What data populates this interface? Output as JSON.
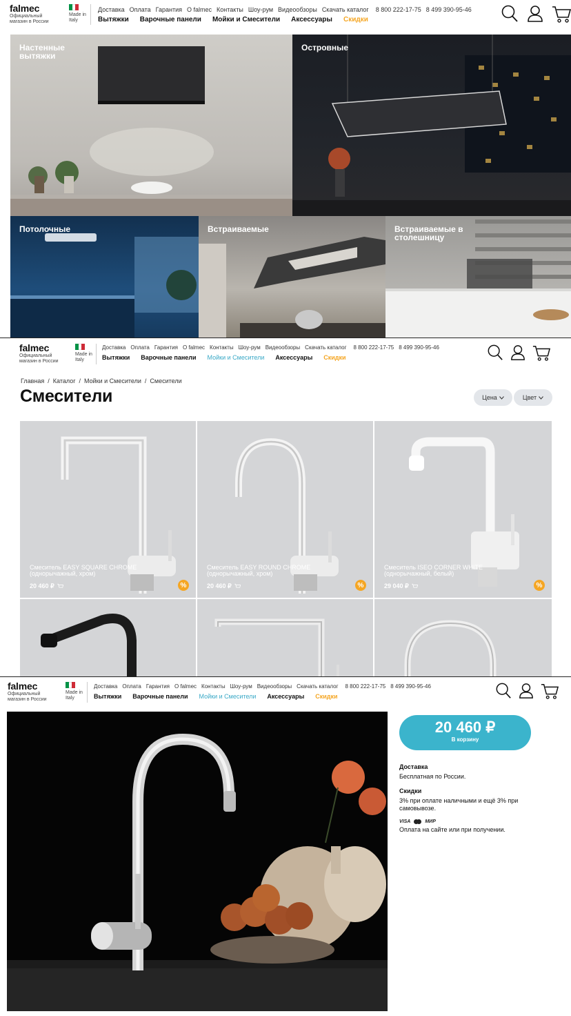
{
  "header": {
    "logo": "falmec",
    "logo_sub": "Официальный магазин в России",
    "made_in": "Made in Italy",
    "top_links": [
      "Доставка",
      "Оплата",
      "Гарантия",
      "О falmec",
      "Контакты",
      "Шоу-рум",
      "Видеообзоры",
      "Скачать каталог"
    ],
    "phones": [
      "8 800 222-17-75",
      "8 499 390-95-46"
    ],
    "main_nav": [
      "Вытяжки",
      "Варочные панели",
      "Мойки и Смесители",
      "Аксессуары",
      "Скидки"
    ],
    "icons": [
      "search-icon",
      "user-icon",
      "cart-icon"
    ],
    "flag_colors": [
      "#009246",
      "#ffffff",
      "#ce2b37"
    ]
  },
  "categories": [
    {
      "label": "Настенные вытяжки"
    },
    {
      "label": "Островные"
    },
    {
      "label": "Потолочные"
    },
    {
      "label": "Встраиваемые"
    },
    {
      "label": "Встраиваемые в столешницу"
    }
  ],
  "catalog": {
    "breadcrumbs": [
      "Главная",
      "Каталог",
      "Мойки и Смесители",
      "Смесители"
    ],
    "title": "Смесители",
    "filters": [
      "Цена",
      "Цвет"
    ],
    "products": [
      {
        "name": "Смеситель EASY SQUARE CHROME (однорычажный, хром)",
        "price": "20 460 ₽",
        "badge": "%"
      },
      {
        "name": "Смеситель EASY ROUND CHROME (однорычажный, хром)",
        "price": "20 460 ₽",
        "badge": "%"
      },
      {
        "name": "Смеситель ISEO CORNER WHITE (однорычажный, белый)",
        "price": "29 040 ₽",
        "badge": "%"
      }
    ]
  },
  "product": {
    "price": "20 460 ₽",
    "cta": "В корзину",
    "delivery_title": "Доставка",
    "delivery_text": "Бесплатная по России.",
    "discount_title": "Скидки",
    "discount_text": "3% при оплате наличными и ещё 3% при самовывозе.",
    "payment_logos": [
      "VISA",
      "МИР"
    ],
    "payment_text": "Оплата на сайте или при получении."
  },
  "colors": {
    "accent": "#3bb4cc",
    "sale": "#f5a623",
    "active_nav": "#3aa9c7"
  }
}
